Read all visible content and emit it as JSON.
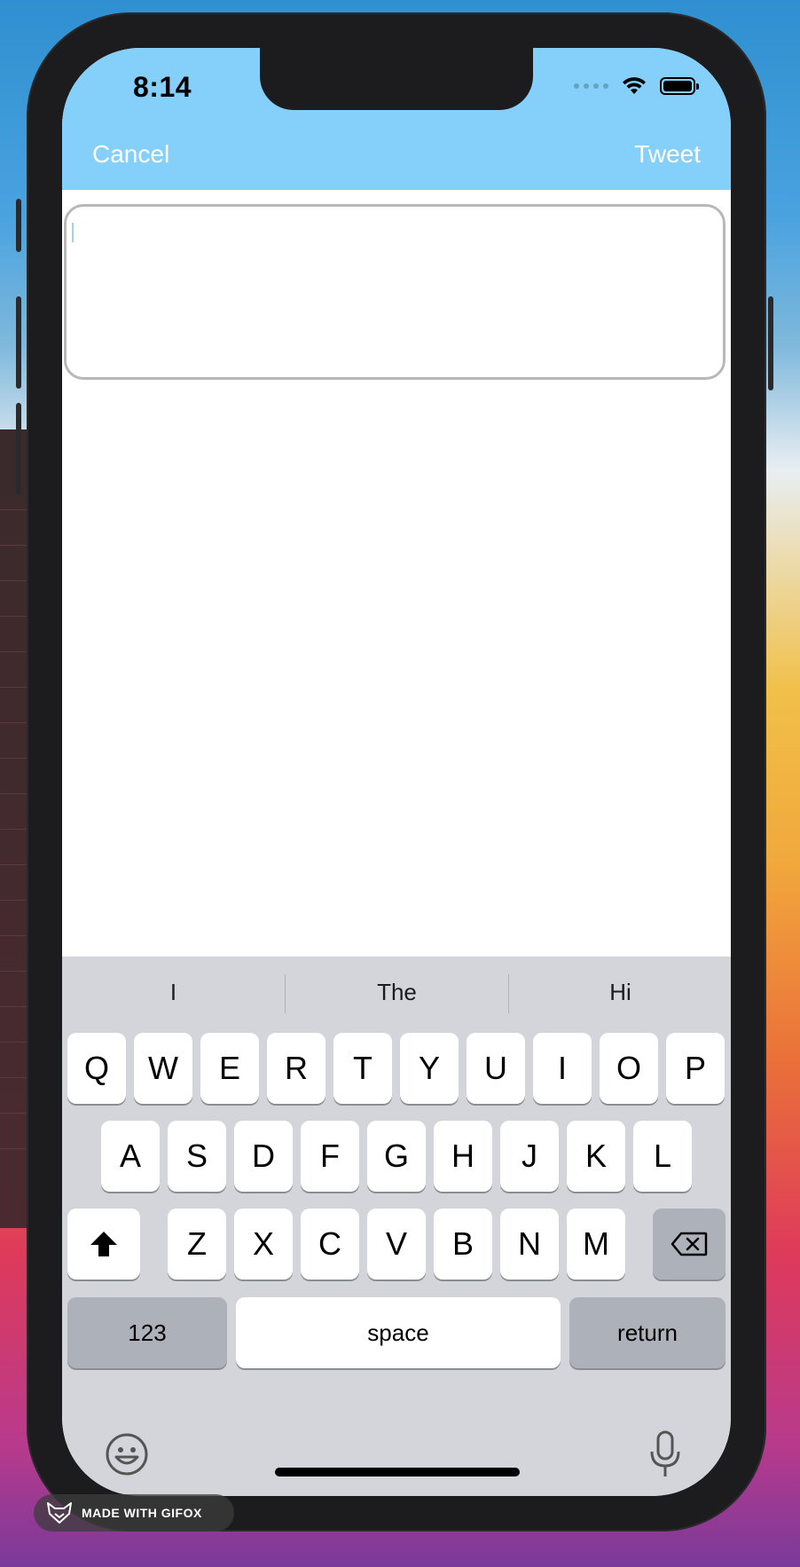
{
  "status_bar": {
    "time": "8:14"
  },
  "nav": {
    "cancel_label": "Cancel",
    "tweet_label": "Tweet"
  },
  "compose": {
    "value": ""
  },
  "keyboard": {
    "suggestions": [
      "I",
      "The",
      "Hi"
    ],
    "row1": [
      "Q",
      "W",
      "E",
      "R",
      "T",
      "Y",
      "U",
      "I",
      "O",
      "P"
    ],
    "row2": [
      "A",
      "S",
      "D",
      "F",
      "G",
      "H",
      "J",
      "K",
      "L"
    ],
    "row3": [
      "Z",
      "X",
      "C",
      "V",
      "B",
      "N",
      "M"
    ],
    "numbers_label": "123",
    "space_label": "space",
    "return_label": "return"
  },
  "colors": {
    "nav_background": "#84d0fb",
    "nav_text": "#ffffff",
    "keyboard_background": "#d3d5db"
  },
  "watermark": {
    "text": "MADE WITH GIFOX"
  }
}
